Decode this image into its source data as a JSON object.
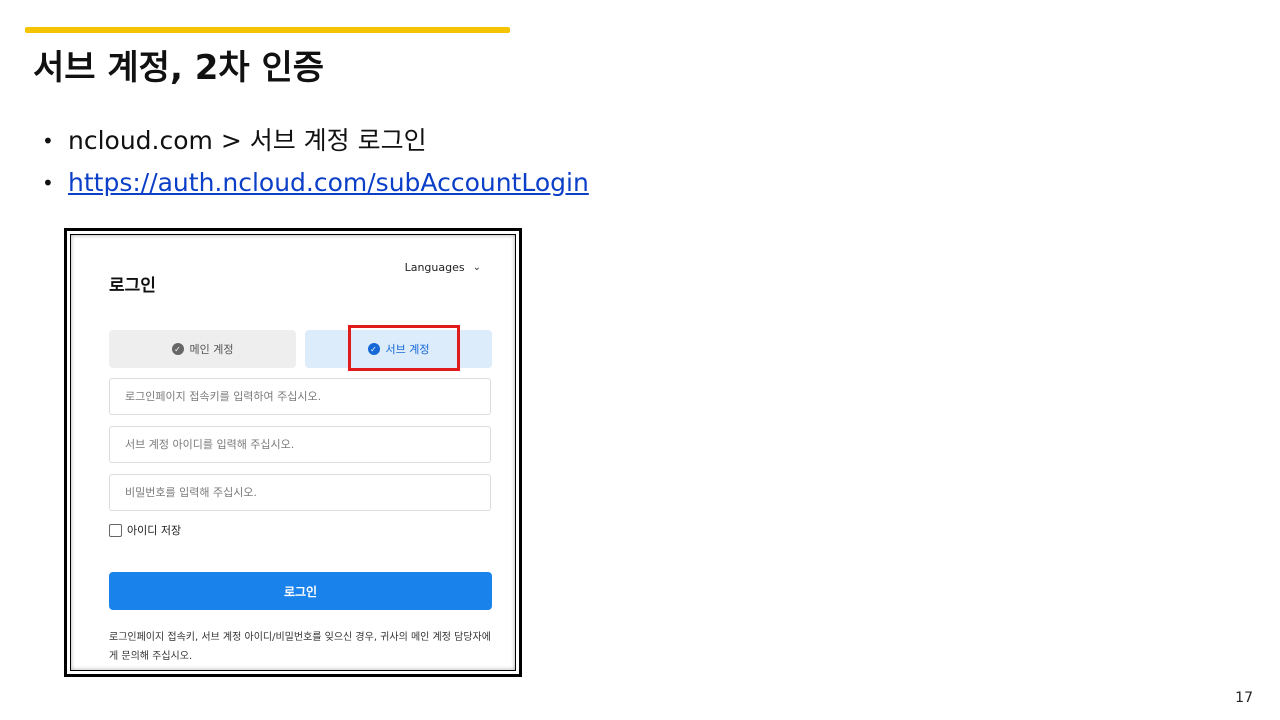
{
  "slide": {
    "title": "서브 계정, 2차 인증",
    "bullets": [
      {
        "text": "ncloud.com > 서브 계정 로그인"
      },
      {
        "text": "https://auth.ncloud.com/subAccountLogin"
      }
    ],
    "page_number": "17",
    "colors": {
      "accent": "#f5c400",
      "link": "#0b3fc7",
      "highlight": "#e01b1b"
    }
  },
  "login": {
    "title": "로그인",
    "languages_label": "Languages",
    "tabs": [
      {
        "label": "메인 계정",
        "icon": "check-circle-icon",
        "selected": false
      },
      {
        "label": "서브 계정",
        "icon": "check-circle-icon",
        "selected": true
      }
    ],
    "fields": [
      {
        "placeholder": "로그인페이지 접속키를 입력하여 주십시오."
      },
      {
        "placeholder": "서브 계정 아이디를 입력해 주십시오."
      },
      {
        "placeholder": "비밀번호를 입력해 주십시오."
      }
    ],
    "remember_label": "아이디 저장",
    "submit_label": "로그인",
    "help_text": "로그인페이지 접속키, 서브 계정 아이디/비밀번호를 잊으신 경우, 귀사의 메인 계정 담당자에게 문의해 주십시오.",
    "colors": {
      "primary": "#1a82eb",
      "tab_selected_bg": "#dcecfb"
    }
  }
}
